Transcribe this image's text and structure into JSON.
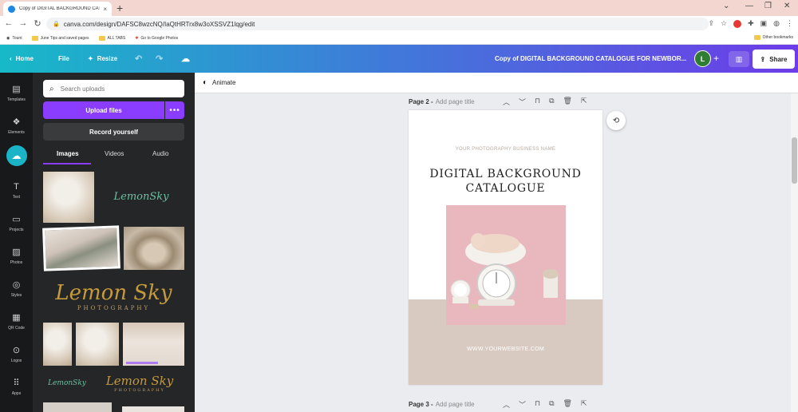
{
  "browser": {
    "tab_title": "Copy of DIGITAL BACKGROUND CATALOGUE FOR",
    "tab_close": "×",
    "new_tab": "+",
    "url": "canva.com/design/DAFSC8wzcNQ/IaQtHRTrx8w3oXSSVZ1lqg/edit",
    "bookmarks": [
      {
        "label": "Tount"
      },
      {
        "label": "June Tips and saved pages"
      },
      {
        "label": "ALL TABS"
      },
      {
        "label": "Go to Google Photos"
      }
    ],
    "other_bookmarks": "Other bookmarks"
  },
  "header": {
    "home": "Home",
    "file": "File",
    "resize": "Resize",
    "design_title": "Copy of DIGITAL BACKGROUND CATALOGUE FOR  NEWBOR...",
    "avatar_letter": "L",
    "share": "Share",
    "gradient": [
      "#17b9c8",
      "#3d7ed8",
      "#6d3ce8"
    ]
  },
  "rail": {
    "items": [
      {
        "label": "Templates",
        "icon": "templates-icon"
      },
      {
        "label": "Elements",
        "icon": "elements-icon"
      },
      {
        "label": "",
        "icon": "upload-cloud-icon"
      },
      {
        "label": "Text",
        "icon": "text-icon"
      },
      {
        "label": "Projects",
        "icon": "folder-icon"
      },
      {
        "label": "Photos",
        "icon": "photos-icon"
      },
      {
        "label": "Styles",
        "icon": "styles-icon"
      },
      {
        "label": "QR Code",
        "icon": "qr-code-icon"
      },
      {
        "label": "Logos",
        "icon": "logos-icon"
      },
      {
        "label": "Apps",
        "icon": "apps-icon"
      }
    ]
  },
  "panel": {
    "search_placeholder": "Search uploads",
    "upload_label": "Upload files",
    "more_label": "•••",
    "record_label": "Record yourself",
    "tabs": [
      "Images",
      "Videos",
      "Audio"
    ],
    "signature_small": "LemonSky",
    "signature_large": "Lemon Sky",
    "signature_sub": "PHOTOGRAPHY",
    "accent": "#8b3dff"
  },
  "workspace": {
    "animate": "Animate",
    "page2_label": "Page 2 -",
    "page2_title_placeholder": "Add page title",
    "page3_label": "Page 3 -",
    "page3_title_placeholder": "Add page title"
  },
  "design_page": {
    "business_name": "YOUR PHOTOGRAPHY BUSINESS NAME",
    "title_line1": "DIGITAL BACKGROUND",
    "title_line2": "CATALOGUE",
    "website": "WWW.YOURWEBSITE.COM",
    "band_color": "#d9cac1",
    "photo_bg": "#e8b7bd"
  }
}
